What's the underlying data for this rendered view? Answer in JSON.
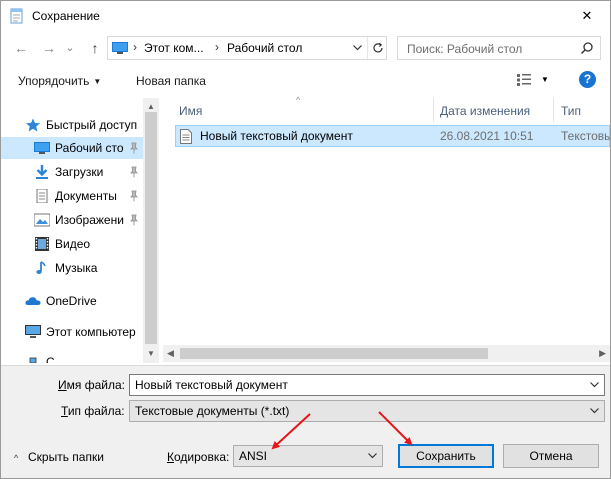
{
  "window": {
    "title": "Сохранение",
    "close_glyph": "✕"
  },
  "nav": {
    "back_glyph": "←",
    "forward_glyph": "→",
    "recent_glyph": "⌄",
    "up_glyph": "↑"
  },
  "address": {
    "crumb_sep": "›",
    "crumbs": [
      "Этот ком...",
      "Рабочий стол"
    ]
  },
  "search": {
    "placeholder": "Поиск: Рабочий стол"
  },
  "toolbar": {
    "organize_label": "Упорядочить",
    "new_folder_label": "Новая папка",
    "help_label": "?"
  },
  "sidebar": {
    "items": [
      {
        "label": "Быстрый доступ",
        "icon": "star-icon"
      },
      {
        "label": "Рабочий сто",
        "icon": "desktop-icon",
        "selected": true,
        "pinned": true
      },
      {
        "label": "Загрузки",
        "icon": "download-icon",
        "pinned": true
      },
      {
        "label": "Документы",
        "icon": "documents-icon",
        "pinned": true
      },
      {
        "label": "Изображени",
        "icon": "pictures-icon",
        "pinned": true
      },
      {
        "label": "Видео",
        "icon": "video-icon"
      },
      {
        "label": "Музыка",
        "icon": "music-icon"
      },
      {
        "label": "OneDrive",
        "icon": "cloud-icon"
      },
      {
        "label": "Этот компьютер",
        "icon": "computer-icon"
      },
      {
        "label": "С...",
        "icon": "network-icon"
      }
    ],
    "pin_glyph": "📌"
  },
  "filelist": {
    "columns": [
      "Имя",
      "Дата изменения",
      "Тип"
    ],
    "sort_glyph": "^",
    "rows": [
      {
        "name": "Новый текстовый документ",
        "date": "26.08.2021 10:51",
        "type": "Текстовы"
      }
    ]
  },
  "scroll": {
    "up_glyph": "▲",
    "down_glyph": "▼",
    "left_glyph": "◀",
    "right_glyph": "▶"
  },
  "form": {
    "filename_label_u": "И",
    "filename_label_rest": "мя файла:",
    "filename_value": "Новый текстовый документ",
    "filetype_label_u": "Т",
    "filetype_label_rest": "ип файла:",
    "filetype_value": "Текстовые документы (*.txt)",
    "hide_folders_caret": "^",
    "hide_folders_label": "Скрыть папки",
    "encoding_label_u": "К",
    "encoding_label_rest": "одировка:",
    "encoding_value": "ANSI",
    "save_label": "Сохранить",
    "cancel_label": "Отмена"
  },
  "colors": {
    "selection": "#cce8ff",
    "accent": "#0078d7",
    "annotation_arrow": "#e8141b"
  }
}
